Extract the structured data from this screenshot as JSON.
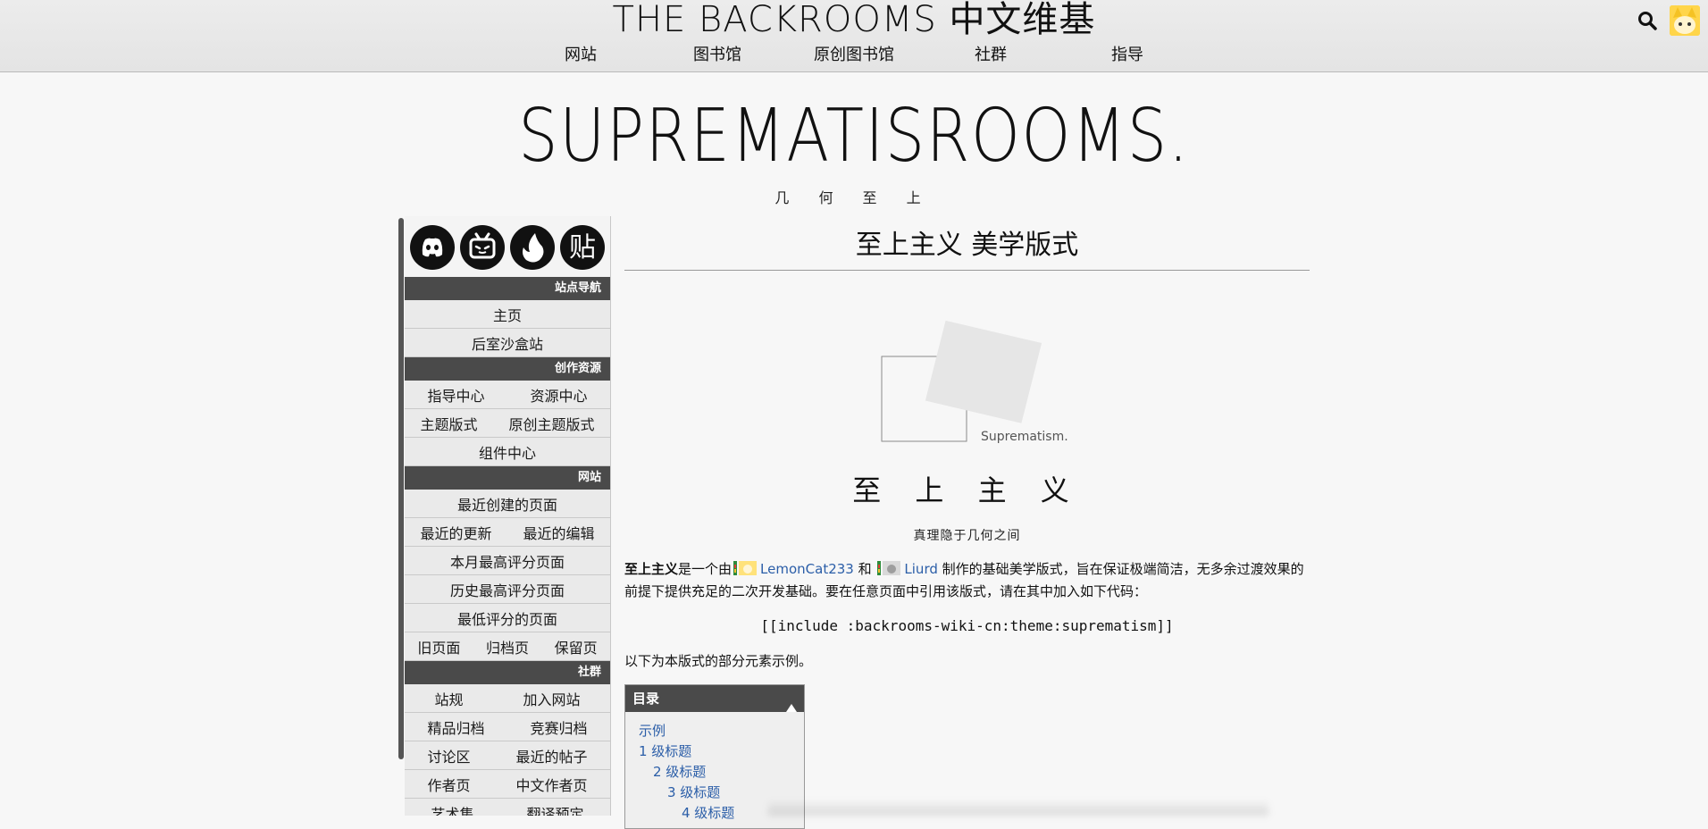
{
  "site": {
    "title": "THE BACKROOMS 中文维基",
    "nav": [
      "网站",
      "图书馆",
      "原创图书馆",
      "社群",
      "指导"
    ]
  },
  "page_header": {
    "title": "SUPREMATISROOMS.",
    "subtitle": "几 何 至 上"
  },
  "sidebar": {
    "social_icons": [
      "discord-icon",
      "bilibili-icon",
      "flame-icon",
      "tieba-icon"
    ],
    "tieba_glyph": "贴",
    "sections": [
      {
        "heading": "站点导航",
        "rows": [
          [
            "主页"
          ],
          [
            "后室沙盒站"
          ]
        ]
      },
      {
        "heading": "创作资源",
        "rows": [
          [
            "指导中心",
            "资源中心"
          ],
          [
            "主题版式",
            "原创主题版式"
          ],
          [
            "组件中心"
          ]
        ]
      },
      {
        "heading": "网站",
        "rows": [
          [
            "最近创建的页面"
          ],
          [
            "最近的更新",
            "最近的编辑"
          ],
          [
            "本月最高评分页面"
          ],
          [
            "历史最高评分页面"
          ],
          [
            "最低评分的页面"
          ],
          [
            "旧页面",
            "归档页",
            "保留页"
          ]
        ]
      },
      {
        "heading": "社群",
        "rows": [
          [
            "站规",
            "加入网站"
          ],
          [
            "精品归档",
            "竞赛归档"
          ],
          [
            "讨论区",
            "最近的帖子"
          ],
          [
            "作者页",
            "中文作者页"
          ],
          [
            "艺术集",
            "翻译预定"
          ]
        ]
      }
    ]
  },
  "main": {
    "theme_title": "至上主义 美学版式",
    "logo_caption": "Suprematism.",
    "big_name": "至 上 主 义",
    "tagline": "真理隐于几何之间",
    "intro": {
      "bold": "至上主义",
      "part1": "是一个由",
      "author1": "LemonCat233",
      "and": "和",
      "author2": "Liurd",
      "part2": "制作的基础美学版式，旨在保证极端简洁，无多余过渡效果的前提下提供充足的二次开发基础。要在任意页面中引用该版式，请在其中加入如下代码："
    },
    "code": "[[include :backrooms-wiki-cn:theme:suprematism]]",
    "followup": "以下为本版式的部分元素示例。",
    "toc": {
      "title": "目录",
      "items": [
        "示例",
        "1 级标题",
        "2 级标题",
        "3 级标题",
        "4 级标题"
      ]
    }
  },
  "colors": {
    "background": "#f7f7f7",
    "header_bar": "#4a4a4a",
    "link": "#2b5ea8"
  }
}
